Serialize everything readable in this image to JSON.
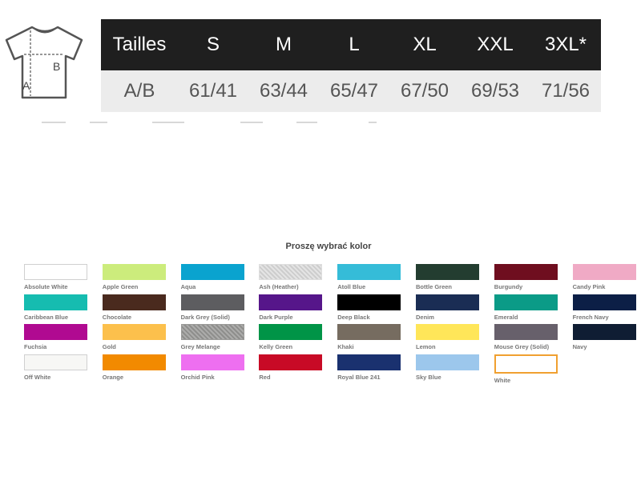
{
  "size_chart": {
    "header_label": "Tailles",
    "sizes": [
      "S",
      "M",
      "L",
      "XL",
      "XXL",
      "3XL*"
    ],
    "row_label": "A/B",
    "values": [
      "61/41",
      "63/44",
      "65/47",
      "67/50",
      "69/53",
      "71/56"
    ],
    "diagram_labels": {
      "a": "A",
      "b": "B"
    }
  },
  "color_picker": {
    "title": "Proszę wybrać kolor",
    "selected": "White",
    "colors": [
      {
        "name": "Absolute White",
        "hex": "#ffffff"
      },
      {
        "name": "Apple Green",
        "hex": "#ccec7c"
      },
      {
        "name": "Aqua",
        "hex": "#0aa3cf"
      },
      {
        "name": "Ash (Heather)",
        "hex": "#dedede"
      },
      {
        "name": "Atoll Blue",
        "hex": "#35bcd8"
      },
      {
        "name": "Bottle Green",
        "hex": "#233d30"
      },
      {
        "name": "Burgundy",
        "hex": "#6f0e1f"
      },
      {
        "name": "Candy Pink",
        "hex": "#f0aac5"
      },
      {
        "name": "Caribbean Blue",
        "hex": "#16bcb0"
      },
      {
        "name": "Chocolate",
        "hex": "#4a2a1e"
      },
      {
        "name": "Dark Grey (Solid)",
        "hex": "#5d5d60"
      },
      {
        "name": "Dark Purple",
        "hex": "#56168a"
      },
      {
        "name": "Deep Black",
        "hex": "#000000"
      },
      {
        "name": "Denim",
        "hex": "#1a2d54"
      },
      {
        "name": "Emerald",
        "hex": "#0b9b87"
      },
      {
        "name": "French Navy",
        "hex": "#0c1f46"
      },
      {
        "name": "Fuchsia",
        "hex": "#b00a91"
      },
      {
        "name": "Gold",
        "hex": "#fcc04c"
      },
      {
        "name": "Grey Melange",
        "hex": "#9a9a98"
      },
      {
        "name": "Kelly Green",
        "hex": "#009447"
      },
      {
        "name": "Khaki",
        "hex": "#766c60"
      },
      {
        "name": "Lemon",
        "hex": "#ffe659"
      },
      {
        "name": "Mouse Grey (Solid)",
        "hex": "#67606b"
      },
      {
        "name": "Navy",
        "hex": "#0f1d33"
      },
      {
        "name": "Off White",
        "hex": "#f7f7f5"
      },
      {
        "name": "Orange",
        "hex": "#f28a00"
      },
      {
        "name": "Orchid Pink",
        "hex": "#ee6ff0"
      },
      {
        "name": "Red",
        "hex": "#c80a26"
      },
      {
        "name": "Royal Blue 241",
        "hex": "#1a316f"
      },
      {
        "name": "Sky Blue",
        "hex": "#9cc7ec"
      },
      {
        "name": "White",
        "hex": "#ffffff"
      }
    ]
  }
}
